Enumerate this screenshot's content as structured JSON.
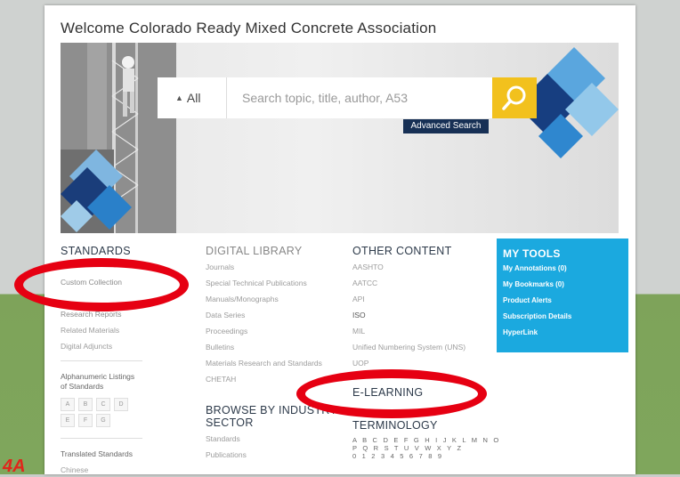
{
  "welcome": "Welcome Colorado Ready Mixed Concrete Association",
  "search": {
    "scope": "All",
    "placeholder": "Search topic, title, author, A53",
    "advanced_label": "Advanced Search"
  },
  "standards": {
    "title": "STANDARDS",
    "links": [
      "Custom Collection",
      "Research Reports",
      "Related Materials",
      "Digital Adjuncts"
    ],
    "alpha_title": "Alphanumeric Listings of Standards",
    "alpha_letters": [
      "A",
      "B",
      "C",
      "D",
      "E",
      "F",
      "G"
    ],
    "translated_label": "Translated Standards",
    "chinese_label": "Chinese"
  },
  "digital_library": {
    "title": "DIGITAL LIBRARY",
    "links": [
      "Journals",
      "Special Technical Publications",
      "Manuals/Monographs",
      "Data Series",
      "Proceedings",
      "Bulletins",
      "Materials Research and Standards",
      "CHETAH"
    ]
  },
  "browse": {
    "title_line1": "BROWSE BY INDUSTRY",
    "title_line2": "SECTOR",
    "links": [
      "Standards",
      "Publications"
    ]
  },
  "other_content": {
    "title": "OTHER CONTENT",
    "links": [
      "AASHTO",
      "AATCC",
      "API",
      "ISO",
      "MIL",
      "Unified Numbering System (UNS)",
      "UOP"
    ]
  },
  "elearning": "E-LEARNING",
  "terminology": {
    "title": "TERMINOLOGY",
    "line1": "A B C D E F G H I J K L M N O",
    "line2": "P Q R S T U V W X Y Z",
    "line3": "0 1 2 3 4 5 6 7 8 9"
  },
  "my_tools": {
    "title": "MY TOOLS",
    "items": [
      "My Annotations (0)",
      "My Bookmarks (0)",
      "Product Alerts",
      "Subscription Details",
      "HyperLink"
    ]
  },
  "logo_text": "4A",
  "colors": {
    "accent_blue": "#1ba9df",
    "search_yellow": "#f2c11d",
    "navy": "#173055",
    "annotation_red": "#e60012"
  }
}
